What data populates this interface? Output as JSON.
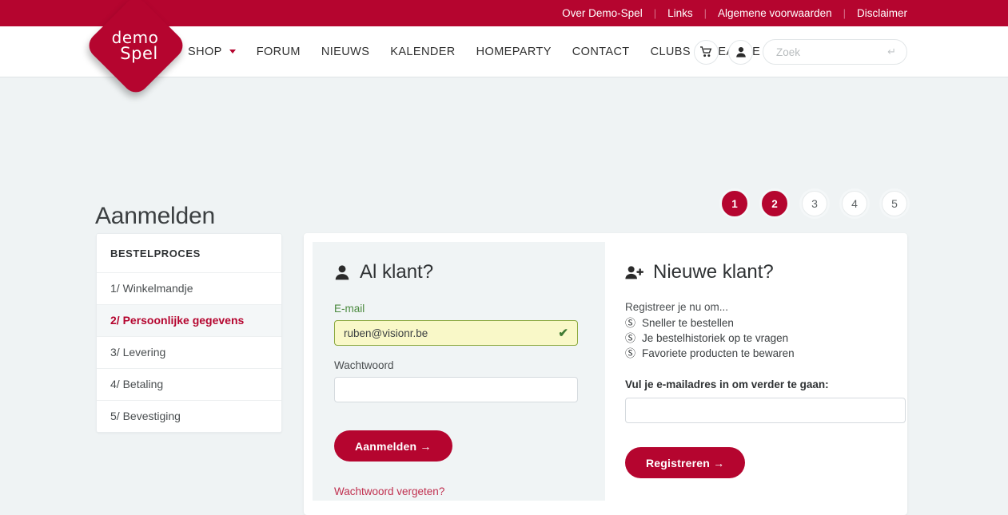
{
  "colors": {
    "brand_red": "#b5052f",
    "page_bg": "#eff3f4",
    "panel_bg": "#f0f4f5",
    "valid_yellow": "#f9f8c8",
    "valid_green": "#8aa83c"
  },
  "topbar": {
    "links": [
      {
        "label": "Over Demo-Spel"
      },
      {
        "label": "Links"
      },
      {
        "label": "Algemene voorwaarden"
      },
      {
        "label": "Disclaimer"
      }
    ]
  },
  "logo": {
    "line1": "demo",
    "line2": "Spel"
  },
  "nav": {
    "items": [
      {
        "label": "SHOP",
        "has_caret": true
      },
      {
        "label": "FORUM",
        "has_caret": false
      },
      {
        "label": "NIEUWS",
        "has_caret": false
      },
      {
        "label": "KALENDER",
        "has_caret": false
      },
      {
        "label": "HOMEPARTY",
        "has_caret": false
      },
      {
        "label": "CONTACT",
        "has_caret": false
      },
      {
        "label": "CLUBS",
        "has_caret": false
      },
      {
        "label": "LEAGUE",
        "has_caret": false
      }
    ]
  },
  "header_actions": {
    "cart_icon": "shopping-cart-icon",
    "account_icon": "user-icon",
    "search": {
      "placeholder": "Zoek",
      "value": "",
      "enter_glyph": "↵"
    }
  },
  "page": {
    "title": "Aanmelden",
    "steps": [
      {
        "label": "1",
        "active": true
      },
      {
        "label": "2",
        "active": true
      },
      {
        "label": "3",
        "active": false
      },
      {
        "label": "4",
        "active": false
      },
      {
        "label": "5",
        "active": false
      }
    ]
  },
  "sidebar": {
    "heading": "BESTELPROCES",
    "items": [
      {
        "label": "1/ Winkelmandje",
        "current": false
      },
      {
        "label": "2/ Persoonlijke gegevens",
        "current": true
      },
      {
        "label": "3/ Levering",
        "current": false
      },
      {
        "label": "4/ Betaling",
        "current": false
      },
      {
        "label": "5/ Bevestiging",
        "current": false
      }
    ]
  },
  "login_panel": {
    "heading": "Al klant?",
    "heading_icon": "user-icon",
    "email_label": "E-mail",
    "email_value": "ruben@visionr.be",
    "email_placeholder": "",
    "email_valid_icon": "check-icon",
    "password_label": "Wachtwoord",
    "password_value": "",
    "password_placeholder": "",
    "submit_label": "Aanmelden →",
    "forgot_link": "Wachtwoord vergeten?"
  },
  "register_panel": {
    "heading": "Nieuwe klant?",
    "heading_icon": "user-plus-icon",
    "intro": "Registreer je nu om...",
    "benefits": [
      {
        "icon": "check-circle-icon",
        "label": "Sneller te bestellen"
      },
      {
        "icon": "check-circle-icon",
        "label": "Je bestelhistoriek op te vragen"
      },
      {
        "icon": "check-circle-icon",
        "label": "Favoriete producten te bewaren"
      }
    ],
    "prompt": "Vul je e-mailadres in om verder te gaan:",
    "email_value": "",
    "email_placeholder": "",
    "submit_label": "Registreren →"
  }
}
